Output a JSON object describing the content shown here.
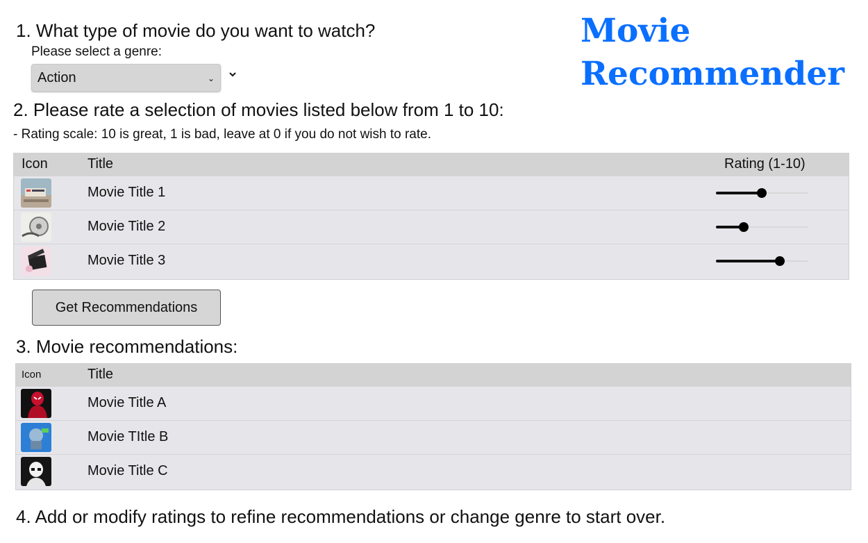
{
  "app": {
    "title_line1": "Movie",
    "title_line2": "Recommender",
    "accent_color": "#0a6fff"
  },
  "step1": {
    "heading": "1. What type of movie do you want to watch?",
    "prompt": "Please select a genre:",
    "selected_genre": "Action"
  },
  "step2": {
    "heading": "2. Please rate a selection of movies listed below from 1 to 10:",
    "note": "- Rating scale: 10 is great, 1 is bad, leave at 0 if you do not wish to rate.",
    "columns": {
      "icon": "Icon",
      "title": "Title",
      "rating": "Rating (1-10)"
    },
    "rating_max": 10,
    "movies": [
      {
        "title": "Movie Title 1",
        "rating": 5,
        "icon": "street-scene-icon"
      },
      {
        "title": "Movie Title 2",
        "rating": 3,
        "icon": "film-reel-icon"
      },
      {
        "title": "Movie Title 3",
        "rating": 7,
        "icon": "clapperboard-icon"
      }
    ],
    "button_label": "Get Recommendations"
  },
  "step3": {
    "heading": "3. Movie recommendations:",
    "columns": {
      "icon": "Icon",
      "title": "Title"
    },
    "movies": [
      {
        "title": "Movie Title A",
        "icon": "spiderman-icon"
      },
      {
        "title": "Movie TItle B",
        "icon": "robot-icon"
      },
      {
        "title": "Movie Title C",
        "icon": "stormtrooper-icon"
      }
    ]
  },
  "step4": {
    "heading": "4. Add or modify ratings to refine recommendations or change genre to start over."
  }
}
